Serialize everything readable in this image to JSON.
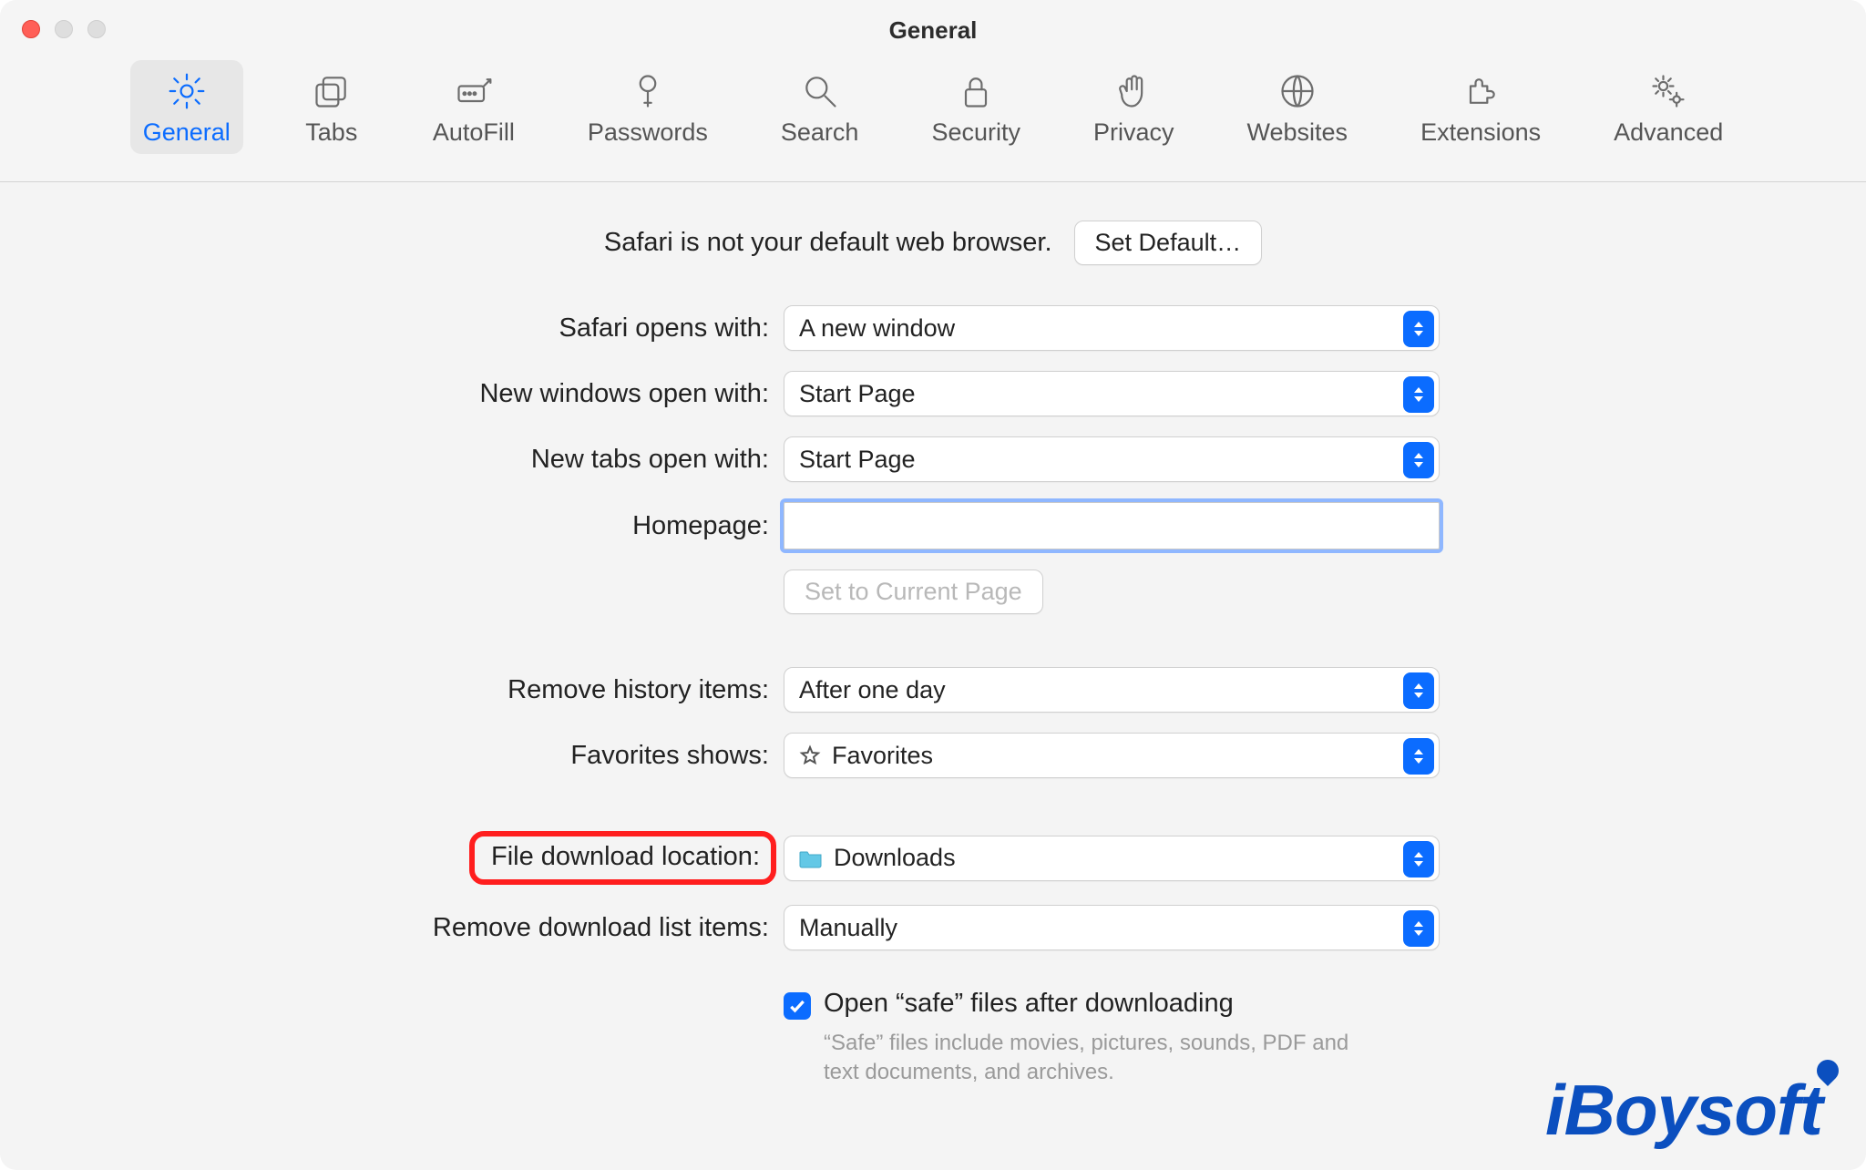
{
  "window": {
    "title": "General"
  },
  "toolbar": {
    "items": [
      {
        "id": "general",
        "label": "General"
      },
      {
        "id": "tabs",
        "label": "Tabs"
      },
      {
        "id": "autofill",
        "label": "AutoFill"
      },
      {
        "id": "passwords",
        "label": "Passwords"
      },
      {
        "id": "search",
        "label": "Search"
      },
      {
        "id": "security",
        "label": "Security"
      },
      {
        "id": "privacy",
        "label": "Privacy"
      },
      {
        "id": "websites",
        "label": "Websites"
      },
      {
        "id": "extensions",
        "label": "Extensions"
      },
      {
        "id": "advanced",
        "label": "Advanced"
      }
    ],
    "active": "general"
  },
  "defaultBrowser": {
    "message": "Safari is not your default web browser.",
    "button": "Set Default…"
  },
  "rows": {
    "opensWith": {
      "label": "Safari opens with:",
      "value": "A new window"
    },
    "newWindows": {
      "label": "New windows open with:",
      "value": "Start Page"
    },
    "newTabs": {
      "label": "New tabs open with:",
      "value": "Start Page"
    },
    "homepage": {
      "label": "Homepage:",
      "value": ""
    },
    "setCurrent": {
      "button": "Set to Current Page"
    },
    "historyRemove": {
      "label": "Remove history items:",
      "value": "After one day"
    },
    "favorites": {
      "label": "Favorites shows:",
      "value": "Favorites"
    },
    "downloadLocation": {
      "label": "File download location:",
      "value": "Downloads"
    },
    "downloadList": {
      "label": "Remove download list items:",
      "value": "Manually"
    },
    "openSafe": {
      "label": "Open “safe” files after downloading",
      "help": "“Safe” files include movies, pictures, sounds, PDF and text documents, and archives."
    }
  },
  "watermark": "iBoysoft"
}
